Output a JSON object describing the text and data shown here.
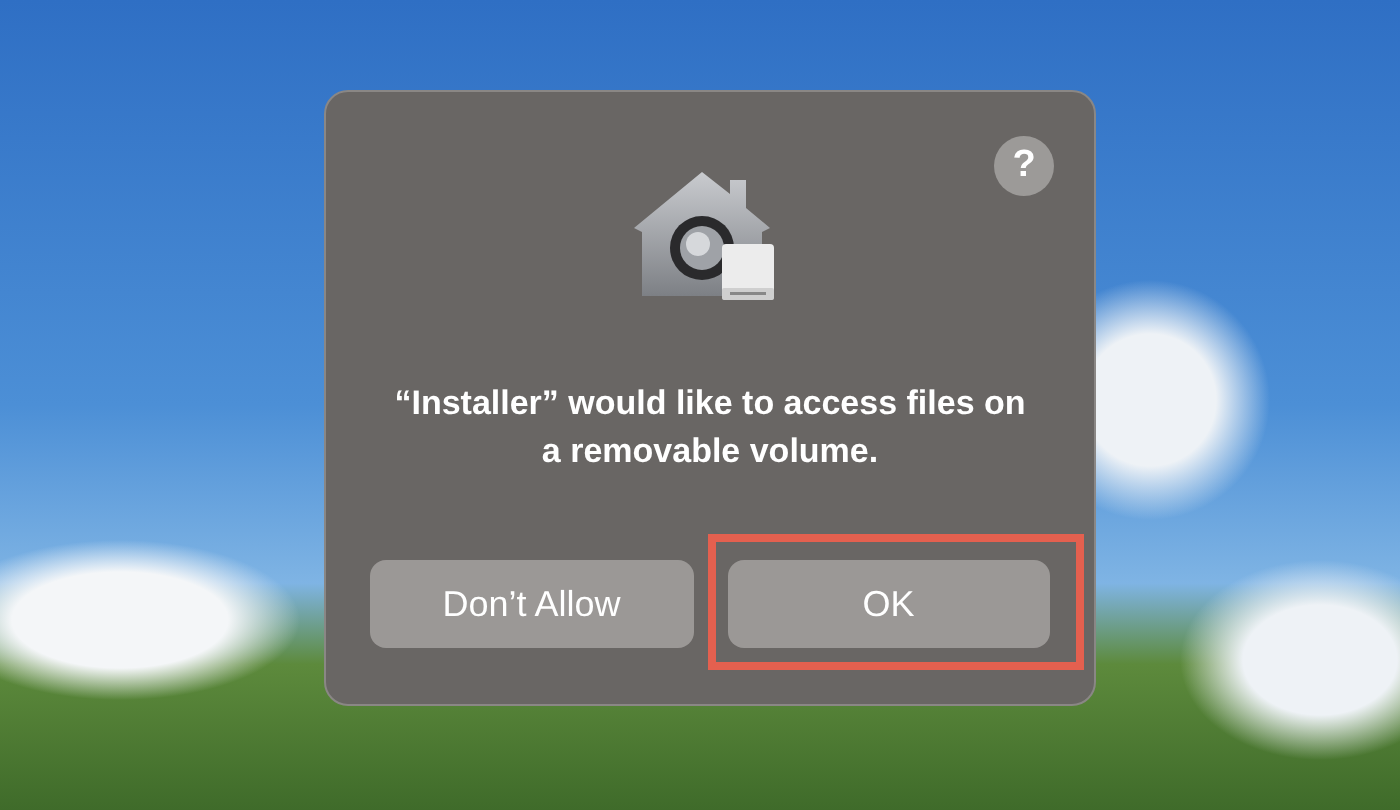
{
  "dialog": {
    "help_label": "?",
    "message": "“Installer” would like to access files on a removable volume.",
    "buttons": [
      {
        "label": "Don’t Allow",
        "highlighted": false
      },
      {
        "label": "OK",
        "highlighted": true
      }
    ]
  }
}
